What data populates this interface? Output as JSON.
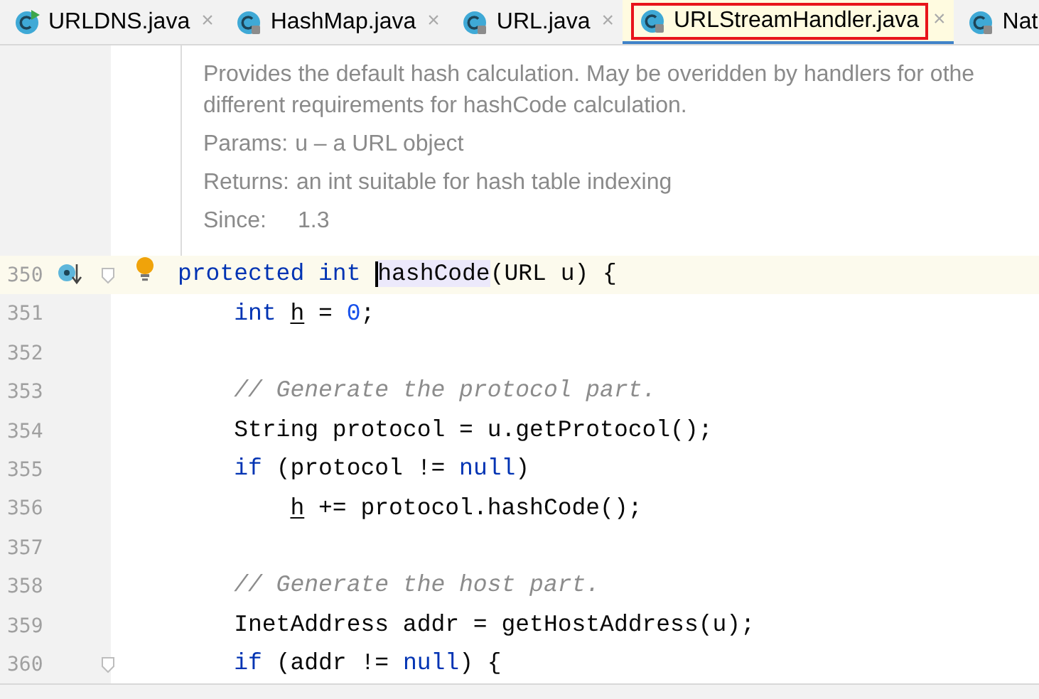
{
  "tabs": [
    {
      "label": "URLDNS.java",
      "selected": false,
      "close": "×",
      "kind": "runnable"
    },
    {
      "label": "HashMap.java",
      "selected": false,
      "close": "×",
      "kind": "locked"
    },
    {
      "label": "URL.java",
      "selected": false,
      "close": "×",
      "kind": "locked"
    },
    {
      "label": "URLStreamHandler.java",
      "selected": true,
      "close": "×",
      "kind": "locked"
    },
    {
      "label": "Nat",
      "selected": false,
      "kind": "locked"
    }
  ],
  "doc": {
    "description": [
      "Provides the default hash calculation. May be overidden by handlers for othe",
      "different requirements for hashCode calculation."
    ],
    "params_label": "Params:",
    "params": "u – a URL object",
    "returns_label": "Returns:",
    "returns": "an int suitable for hash table indexing",
    "since_label": "Since:",
    "since": "1.3"
  },
  "code_lines": [
    {
      "number": "350",
      "current": true,
      "implemented_marker": true,
      "fold_marker": true,
      "bulb": true,
      "tokens": [
        {
          "kind": "kw",
          "text": "protected int "
        },
        {
          "kind": "match",
          "text": "hashCode",
          "caret": true
        },
        {
          "kind": "plain",
          "text": "(URL u) {"
        }
      ]
    },
    {
      "number": "351",
      "current": false,
      "fold_marker": false,
      "tokens": [
        {
          "kind": "kw",
          "text": "    int "
        },
        {
          "kind": "var",
          "text": "h"
        },
        {
          "kind": "plain",
          "text": " = "
        },
        {
          "kind": "num",
          "text": "0"
        },
        {
          "kind": "plain",
          "text": ";"
        }
      ]
    },
    {
      "number": "352",
      "current": false,
      "fold_marker": false
    },
    {
      "number": "353",
      "current": false,
      "fold_marker": false,
      "tokens": [
        {
          "kind": "comment",
          "text": "    // Generate the protocol part."
        }
      ]
    },
    {
      "number": "354",
      "current": false,
      "fold_marker": false,
      "tokens": [
        {
          "kind": "plain",
          "text": "    String protocol = u.getProtocol();"
        }
      ]
    },
    {
      "number": "355",
      "current": false,
      "fold_marker": false,
      "tokens": [
        {
          "kind": "kw",
          "text": "    if"
        },
        {
          "kind": "plain",
          "text": " (protocol != "
        },
        {
          "kind": "kw",
          "text": "null"
        },
        {
          "kind": "plain",
          "text": ")"
        }
      ]
    },
    {
      "number": "356",
      "current": false,
      "fold_marker": false,
      "tokens": [
        {
          "kind": "var",
          "text": "        h"
        },
        {
          "kind": "plain",
          "text": " += protocol.hashCode();"
        }
      ]
    },
    {
      "number": "357",
      "current": false,
      "fold_marker": false
    },
    {
      "number": "358",
      "current": false,
      "fold_marker": false,
      "tokens": [
        {
          "kind": "comment",
          "text": "    // Generate the host part."
        }
      ]
    },
    {
      "number": "359",
      "current": false,
      "fold_marker": false,
      "tokens": [
        {
          "kind": "plain",
          "text": "    InetAddress addr = getHostAddress(u);"
        }
      ]
    },
    {
      "number": "360",
      "current": false,
      "fold_marker": true,
      "tokens": [
        {
          "kind": "kw",
          "text": "    if"
        },
        {
          "kind": "plain",
          "text": " (addr != "
        },
        {
          "kind": "kw",
          "text": "null"
        },
        {
          "kind": "plain",
          "text": ") {"
        }
      ]
    }
  ]
}
